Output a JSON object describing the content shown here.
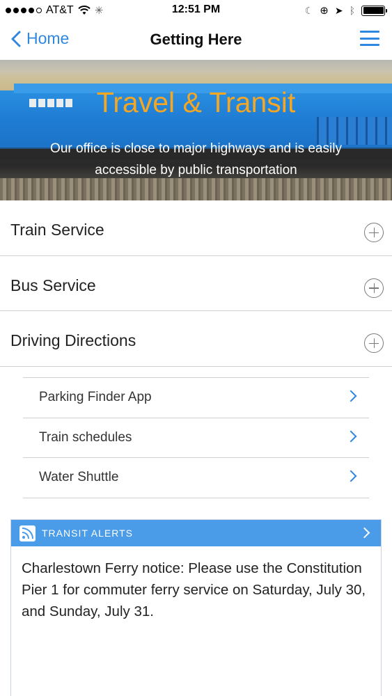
{
  "status_bar": {
    "carrier": "AT&T",
    "time": "12:51 PM",
    "signal_bars": 4,
    "battery_level": 1.0,
    "icons": [
      "wifi-icon",
      "activity-icon",
      "moon-icon",
      "rotation-lock-icon",
      "location-icon",
      "bluetooth-icon",
      "battery-icon"
    ]
  },
  "nav": {
    "back_label": "Home",
    "title": "Getting Here",
    "menu_icon": "hamburger-menu-icon"
  },
  "hero": {
    "title": "Travel & Transit",
    "subtitle": "Our office is close to major highways and is easily accessible by public transportation",
    "title_color": "#f5a623"
  },
  "accordion": {
    "items": [
      {
        "label": "Train Service"
      },
      {
        "label": "Bus Service"
      },
      {
        "label": "Driving Directions"
      }
    ],
    "expand_icon": "plus-circle-icon"
  },
  "links": {
    "items": [
      {
        "label": "Parking Finder App"
      },
      {
        "label": "Train schedules"
      },
      {
        "label": "Water Shuttle"
      }
    ],
    "chevron_icon": "chevron-right-icon"
  },
  "alerts": {
    "header": "TRANSIT ALERTS",
    "icon": "rss-icon",
    "body": "Charlestown Ferry notice: Please use the Constitution Pier 1 for commuter ferry service on Saturday, July 30, and Sunday, July 31.",
    "header_color": "#4a9be8"
  },
  "colors": {
    "accent": "#2f88e0",
    "divider": "#cfcfcf"
  }
}
